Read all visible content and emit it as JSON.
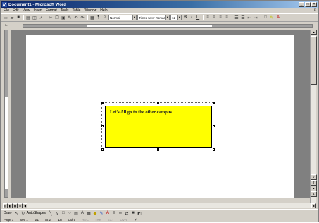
{
  "window": {
    "title": "Document1 - Microsoft Word"
  },
  "menu": [
    "File",
    "Edit",
    "View",
    "Insert",
    "Format",
    "Tools",
    "Table",
    "Window",
    "Help"
  ],
  "formatting": {
    "style": "Normal",
    "font": "Times New Roman",
    "size": "12"
  },
  "document": {
    "textbox_text": "Let's All go to the other campus"
  },
  "drawing_toolbar": {
    "draw_label": "Draw",
    "autoshapes_label": "AutoShapes"
  },
  "statusbar": {
    "page": "Page 1",
    "section": "Sec 1",
    "page_of": "1/1",
    "at": "At 2\"",
    "ln": "Ln",
    "col": "Col 5",
    "modes": [
      "REC",
      "TRK",
      "EXT",
      "OVR"
    ]
  },
  "colors": {
    "textbox_fill": "#ffff00",
    "titlebar": "#0a246a"
  }
}
